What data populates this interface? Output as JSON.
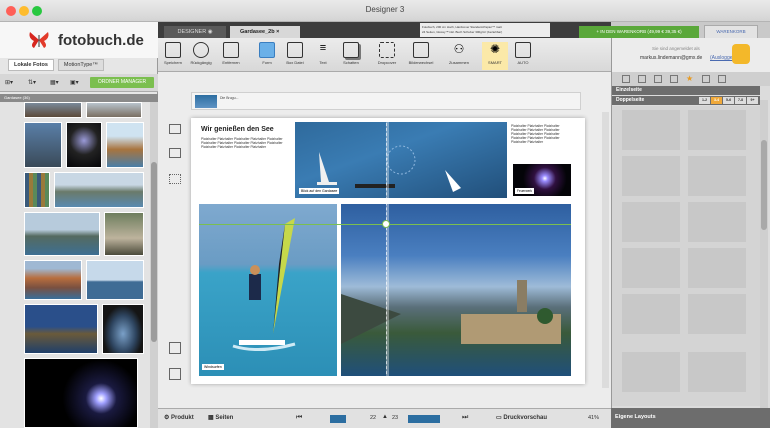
{
  "window": {
    "title": "Designer 3"
  },
  "logo": {
    "text": "fotobuch.de"
  },
  "left": {
    "tabs": [
      {
        "label": "Lokale Fotos"
      },
      {
        "label": "MotionType™"
      }
    ],
    "create_label": "ORDNER MANAGER",
    "grid_header": "Gardasee (36)"
  },
  "tabs": {
    "designer": "DESIGNER",
    "doc": "Gardasee_2b"
  },
  "info": {
    "line1": "Fotobuch, 200 cm Hoch, Hardcover Standard-Papier™ matt",
    "line2": "24 Seiten, Glossy™ inkl. Buch Schuber 300g/m² (beziehbar)"
  },
  "cart": {
    "label": "IN DEN WARENKORB (49,99 € 39,35 €)"
  },
  "warenkorb": {
    "label": "WARENKORB"
  },
  "toolbar": [
    {
      "name": "speichern",
      "label": "Speichern"
    },
    {
      "name": "rueckgaengig",
      "label": "Rückgängig"
    },
    {
      "name": "entfernen",
      "label": "Entfernen"
    },
    {
      "name": "form",
      "label": "Form"
    },
    {
      "name": "box-datei",
      "label": "Box Datei"
    },
    {
      "name": "text",
      "label": "Text"
    },
    {
      "name": "schatten",
      "label": "Schatten"
    },
    {
      "name": "dropcover",
      "label": "Dropcover"
    },
    {
      "name": "bildwechsel",
      "label": "Bilderwechsel"
    },
    {
      "name": "zusammen",
      "label": "Zusammen"
    },
    {
      "name": "smart",
      "label": "SMART"
    },
    {
      "name": "auto",
      "label": "AUTO"
    }
  ],
  "right": {
    "login_line1": "Sie sind angemeldet als",
    "login_email": "markus.lindemann@gmx.de",
    "logout": "(Ausloggen)",
    "einzelseite": "Einzelseite",
    "doppelseite": "Doppelseite",
    "filters": [
      "1-2",
      "3-4",
      "5-6",
      "7-8",
      "9+"
    ],
    "active_filter": 1,
    "eigene": "Eigene Layouts"
  },
  "page": {
    "title": "Wir genießen den See",
    "body": "Platzhalter Platzhalter Platzhalter Platzhalter Platzhalter Platzhalter Platzhalter Platzhalter Platzhalter Platzhalter Platzhalter Platzhalter Platzhalter Platzhalter",
    "right_text": "Platzhalter Platzhalter Platzhalter Platzhalter Platzhalter Platzhalter Platzhalter Platzhalter Platzhalter Platzhalter Platzhalter Platzhalter Platzhalter Platzhalter",
    "caption1": "Blick auf den Gardasee",
    "caption2": "Feuerwerk",
    "caption3": "Windsurfen",
    "thumb_label": "Die Brugu..."
  },
  "bottom": {
    "produkt": "Produkt",
    "seiten": "Seiten",
    "page_from": "22",
    "page_to": "23",
    "druckvorschau": "Druckvorschau",
    "zoom": "41%"
  },
  "colors": {
    "green": "#5aa83a",
    "orange": "#f0a93a",
    "lake": "#2c6ea1"
  }
}
